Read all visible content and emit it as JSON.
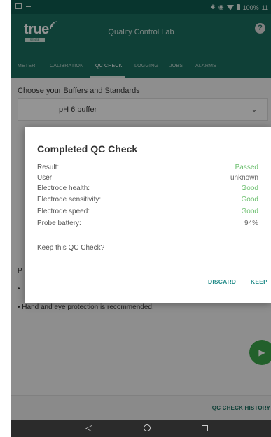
{
  "status_bar": {
    "battery_text": "100%",
    "time_text": "11"
  },
  "app_bar": {
    "logo_word": "true",
    "logo_tag": "SENSE",
    "title": "Quality Control Lab",
    "help_glyph": "?"
  },
  "tabs": [
    {
      "label": "METER"
    },
    {
      "label": "CALIBRATION"
    },
    {
      "label": "QC CHECK"
    },
    {
      "label": "LOGGING"
    },
    {
      "label": "JOBS"
    },
    {
      "label": "ALARMS"
    }
  ],
  "content": {
    "section_label": "Choose your Buffers and Standards",
    "buffer_select_value": "pH 6 buffer",
    "partial_line_1": "P",
    "partial_line_2": "•",
    "safety_note": "• Hand and eye protection is recommended.",
    "qc_history_link": "QC CHECK HISTORY"
  },
  "dialog": {
    "title": "Completed QC Check",
    "rows": [
      {
        "label": "Result:",
        "value": "Passed"
      },
      {
        "label": "User:",
        "value": "unknown"
      },
      {
        "label": "Electrode health:",
        "value": "Good"
      },
      {
        "label": "Electrode sensitivity:",
        "value": "Good"
      },
      {
        "label": "Electrode speed:",
        "value": "Good"
      },
      {
        "label": "Probe battery:",
        "value": "94%"
      }
    ],
    "question": "Keep this QC Check?",
    "discard_label": "DISCARD",
    "keep_label": "KEEP"
  },
  "colors": {
    "primary": "#1b6e5f",
    "good_value": "#6bbf6e",
    "dialog_action": "#1f8a87",
    "fab": "#3ca64a"
  },
  "icons": {
    "help": "help-icon",
    "dropdown": "chevron-down-icon",
    "fab": "play-icon",
    "nav_back": "back-triangle-icon",
    "nav_home": "home-circle-icon",
    "nav_recents": "recents-square-icon"
  }
}
